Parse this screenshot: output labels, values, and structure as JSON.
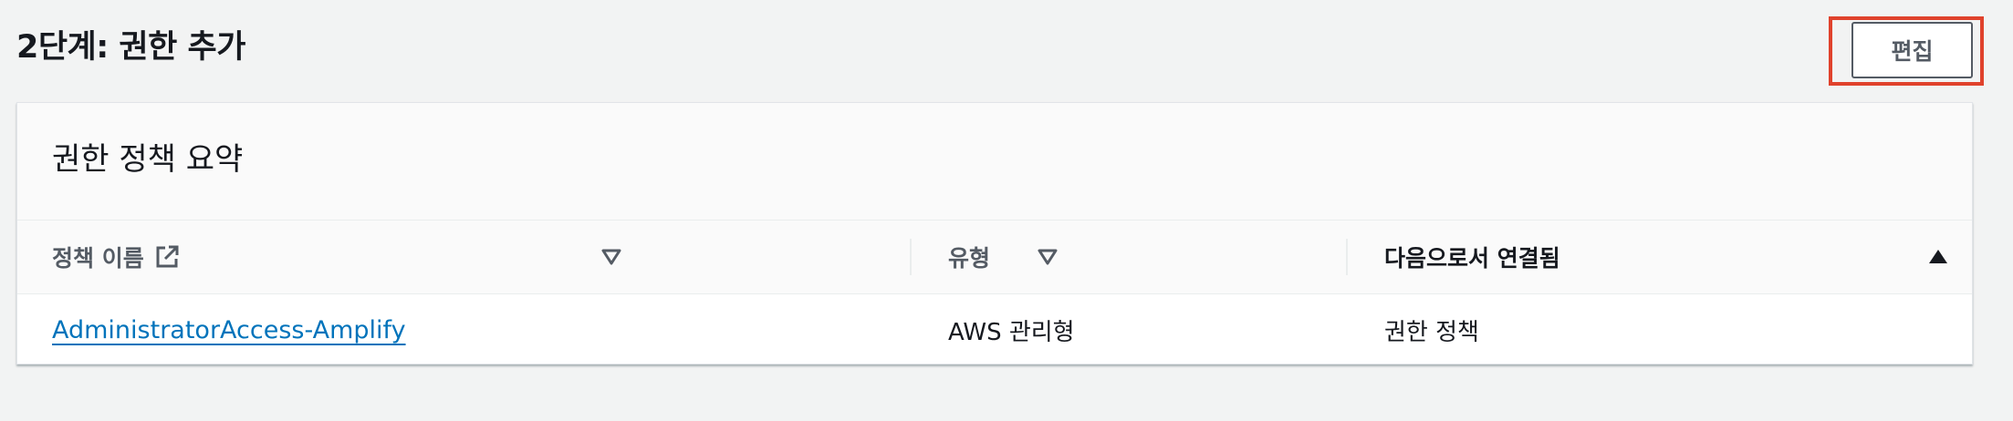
{
  "header": {
    "step_title": "2단계: 권한 추가",
    "edit_label": "편집"
  },
  "panel": {
    "title": "권한 정책 요약",
    "columns": [
      {
        "label": "정책 이름",
        "sort": "none",
        "icon": "external-link-icon"
      },
      {
        "label": "유형",
        "sort": "none"
      },
      {
        "label": "다음으로서 연결됨",
        "sort": "ascending"
      }
    ],
    "rows": [
      {
        "policy_name": "AdministratorAccess-Amplify",
        "type": "AWS 관리형",
        "attached_as": "권한 정책"
      }
    ]
  },
  "colors": {
    "highlight": "#e0422c",
    "link": "#0073bb",
    "background": "#f2f3f3"
  }
}
